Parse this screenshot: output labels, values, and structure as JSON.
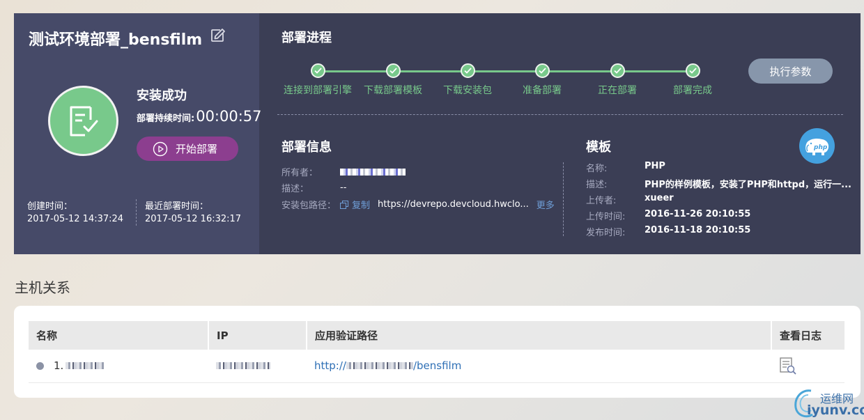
{
  "deployment": {
    "title": "测试环境部署_bensfilm",
    "status": "安装成功",
    "duration_label": "部署持续时间:",
    "duration_value": "00:00:57",
    "start_button": "开始部署",
    "created_label": "创建时间：",
    "created_value": "2017-05-12 14:37:24",
    "recent_label": "最近部署时间：",
    "recent_value": "2017-05-12 16:32:17"
  },
  "progress": {
    "title": "部署进程",
    "steps": [
      "连接到部署引擎",
      "下载部署模板",
      "下载安装包",
      "准备部署",
      "正在部署",
      "部署完成"
    ],
    "exec_button": "执行参数",
    "accent_color": "#78c98b"
  },
  "deploy_info": {
    "title": "部署信息",
    "owner_label": "所有者：",
    "desc_label": "描述：",
    "desc_value": "--",
    "package_label": "安装包路径：",
    "copy_label": "复制",
    "package_path": "https://devrepo.devcloud.hwclo...",
    "more_label": "更多"
  },
  "template": {
    "title": "模板",
    "logo_text": "php",
    "name_label": "名称:",
    "name_value": "PHP",
    "desc_label": "描述:",
    "desc_value": "PHP的样例模板，安装了PHP和httpd，运行一...",
    "uploader_label": "上传者:",
    "uploader_value": "xueer",
    "upload_time_label": "上传时间:",
    "upload_time_value": "2016-11-26 20:10:55",
    "publish_time_label": "发布时间:",
    "publish_time_value": "2016-11-18 20:10:55"
  },
  "hosts": {
    "title": "主机关系",
    "columns": [
      "名称",
      "IP",
      "应用验证路径",
      "查看日志"
    ],
    "rows": [
      {
        "name_prefix": "1.",
        "url_prefix": "http://",
        "url_suffix": "/bensfilm"
      }
    ]
  },
  "watermark": {
    "line1": "运维网",
    "line2": "iyunv.com"
  }
}
